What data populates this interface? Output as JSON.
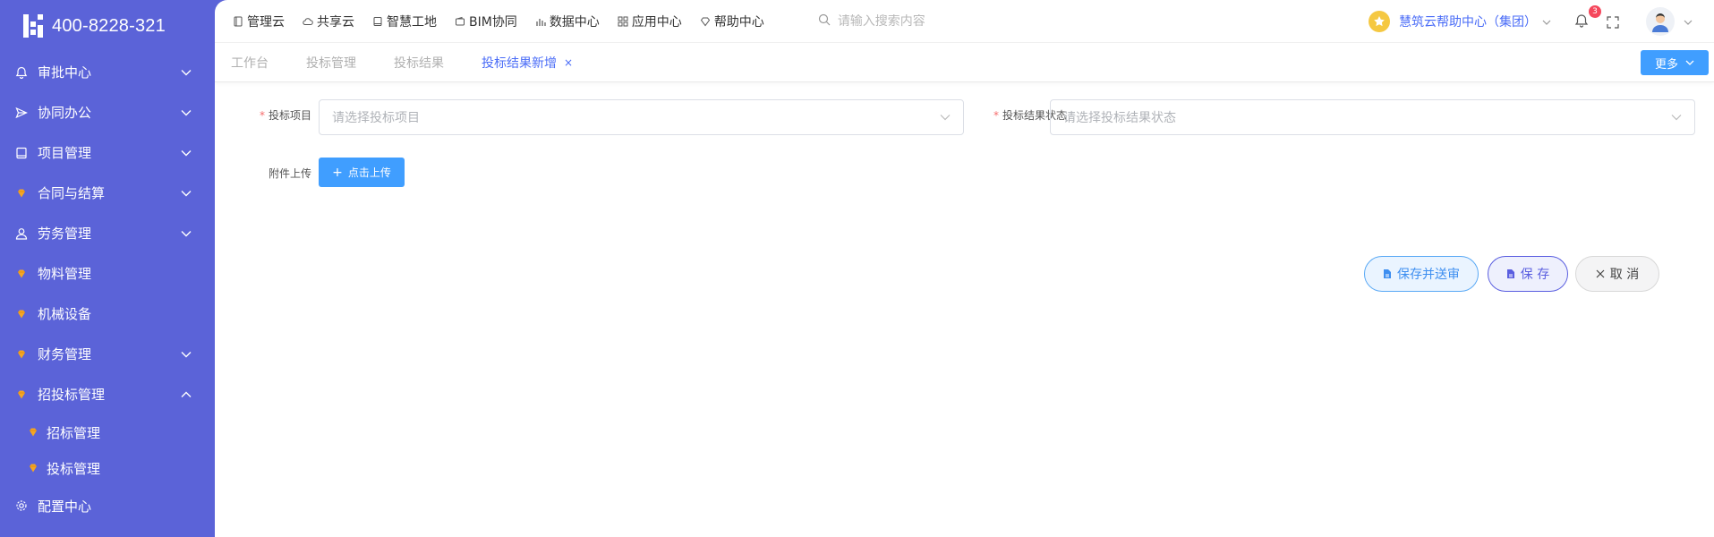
{
  "sidebar": {
    "logo_text": "400-8228-321",
    "items": [
      {
        "label": "审批中心",
        "icon": "bell-icon"
      },
      {
        "label": "协同办公",
        "icon": "send-icon"
      },
      {
        "label": "项目管理",
        "icon": "book-icon"
      },
      {
        "label": "合同与结算",
        "icon": "gem-icon"
      },
      {
        "label": "劳务管理",
        "icon": "user-icon"
      },
      {
        "label": "物料管理",
        "icon": "gem-icon"
      },
      {
        "label": "机械设备",
        "icon": "gem-icon"
      },
      {
        "label": "财务管理",
        "icon": "gem-icon"
      },
      {
        "label": "招投标管理",
        "icon": "gem-icon"
      }
    ],
    "sub_items": [
      {
        "label": "招标管理",
        "icon": "gem-icon"
      },
      {
        "label": "投标管理",
        "icon": "gem-icon"
      }
    ],
    "config": {
      "label": "配置中心",
      "icon": "gear-icon"
    }
  },
  "topbar": {
    "menu": [
      {
        "label": "管理云",
        "icon": "doc-icon"
      },
      {
        "label": "共享云",
        "icon": "cloud-icon"
      },
      {
        "label": "智慧工地",
        "icon": "book-icon"
      },
      {
        "label": "BIM协同",
        "icon": "wallet-icon"
      },
      {
        "label": "数据中心",
        "icon": "bar-chart-icon"
      },
      {
        "label": "应用中心",
        "icon": "grid-icon"
      },
      {
        "label": "帮助中心",
        "icon": "diamond-icon"
      }
    ],
    "search_placeholder": "请输入搜索内容",
    "help_center": "慧筑云帮助中心（集团）",
    "notification_count": "3"
  },
  "tabs": [
    {
      "label": "工作台",
      "active": false
    },
    {
      "label": "投标管理",
      "active": false
    },
    {
      "label": "投标结果",
      "active": false
    },
    {
      "label": "投标结果新增",
      "active": true,
      "close": "×"
    }
  ],
  "more_label": "更多",
  "form": {
    "project_label": "投标项目",
    "project_placeholder": "请选择投标项目",
    "status_label": "投标结果状态",
    "status_placeholder": "请选择投标结果状态",
    "attach_label": "附件上传",
    "upload_label": "点击上传",
    "required_mark": "*"
  },
  "actions": {
    "submit_label": "保存并送审",
    "save_label": "保 存",
    "cancel_label": "取 消"
  },
  "colors": {
    "sidebar_bg": "#5b63d8",
    "primary": "#409eff",
    "accent": "#4a6cf7",
    "gem": "#f5a623"
  }
}
